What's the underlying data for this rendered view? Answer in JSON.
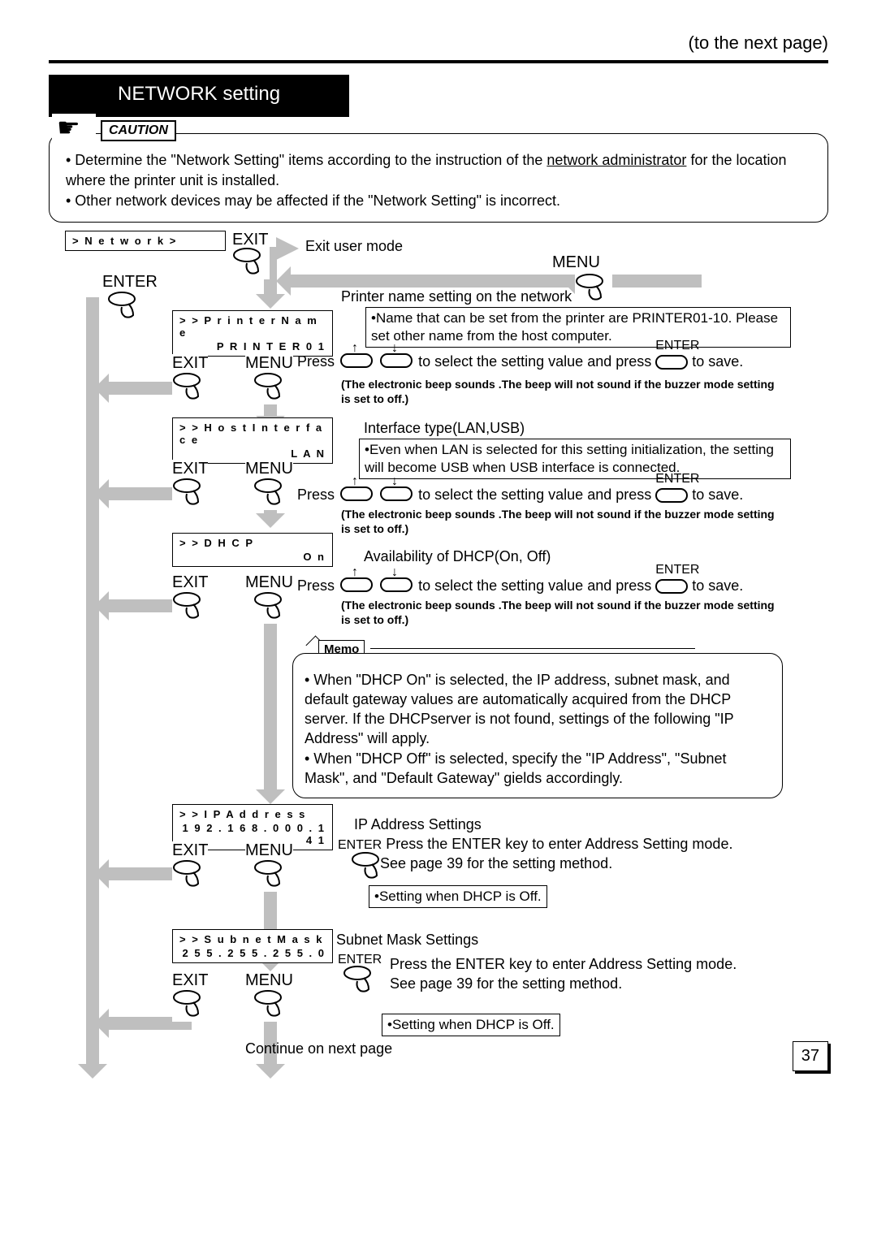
{
  "header": {
    "to_next": "(to the next page)",
    "title": "NETWORK setting"
  },
  "caution": {
    "tag": "CAUTION",
    "line1a": "• Determine the \"Network Setting\" items  according to the instruction of the ",
    "line1u": "network administrator",
    "line1b": " for the location where the printer unit is installed.",
    "line2": "• Other network devices may be affected if the \"Network Setting\" is incorrect."
  },
  "lcd": {
    "network": "> N e t w o r k >",
    "printer_name_l1": "> > P r i n t e r   N a m e",
    "printer_name_l2": "P R I N T E R   0 1",
    "host_l1": "> > H o s t   I n t e r f a c e",
    "host_l2": "L A N",
    "dhcp_l1": "> > D H C P",
    "dhcp_l2": "O n",
    "ip_l1": "> > I P   A d d r e s s",
    "ip_l2": "1 9 2 . 1 6 8 . 0 0 0 . 1 4 1",
    "subnet_l1": "> > S u b n e t   M a s k",
    "subnet_l2": "2 5 5 . 2 5 5 . 2 5 5 . 0"
  },
  "labels": {
    "exit": "EXIT",
    "menu": "MENU",
    "enter": "ENTER",
    "press": "Press",
    "tosave": " to save.",
    "selectvalue": " to select the setting value and press ",
    "exit_user_mode": "  Exit user mode",
    "printer_name_desc": "Printer name setting on the network",
    "printer_callout": "•Name that can be set from the printer are PRINTER01-10. Please set other name from the host computer.",
    "beep": "(The electronic beep sounds .The beep will not sound if the buzzer mode setting is set to off.)",
    "host_desc": "Interface type(LAN,USB)",
    "host_callout": "•Even when LAN is selected for this setting initialization, the setting will become USB when USB interface is connected.",
    "dhcp_desc": "Availability of DHCP(On, Off)",
    "ip_desc": "IP Address Settings",
    "ip_line1": " Press the ENTER key to enter Address Setting mode.",
    "ip_line2": "See page 39 for the setting method.",
    "ip_callout": "•Setting when DHCP is Off.",
    "subnet_desc": "Subnet Mask Settings",
    "subnet_line1": "Press the ENTER key to enter Address Setting mode.",
    "subnet_line2": "See page 39 for the setting method.",
    "subnet_callout": "•Setting when DHCP is Off.",
    "continue": "Continue on next page"
  },
  "memo": {
    "tag": "Memo",
    "b1": "• When \"DHCP On\" is selected, the IP address, subnet mask, and default gateway values are automatically acquired from the DHCP server. If the DHCPserver is not found, settings of the following \"IP Address\" will apply.",
    "b2": "• When \"DHCP Off\" is selected, specify the \"IP Address\", \"Subnet Mask\", and \"Default Gateway\" gields accordingly."
  },
  "page_number": "37"
}
